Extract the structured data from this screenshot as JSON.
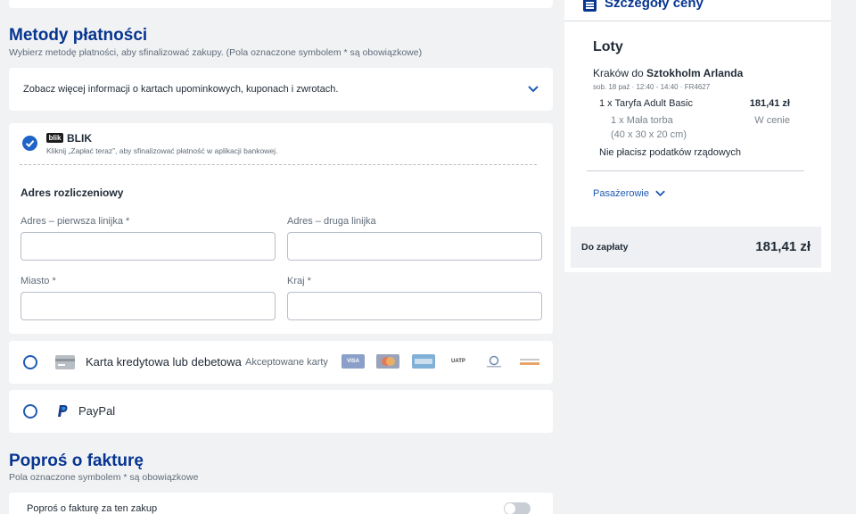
{
  "payment_methods": {
    "title": "Metody płatności",
    "subtitle": "Wybierz metodę płatności, aby sfinalizować zakupy.   (Pola oznaczone symbolem * są obowiązkowe)",
    "info_text": "Zobacz więcej informacji o kartach upominkowych, kuponach i zwrotach."
  },
  "blik": {
    "logo_text": "blik",
    "title": "BLIK",
    "description": "Kliknij „Zapłać teraz”, aby sfinalizować płatność w aplikacji bankowej.",
    "selected": true
  },
  "billing": {
    "title": "Adres rozliczeniowy",
    "address1_label": "Adres – pierwsza linijka *",
    "address2_label": "Adres – druga linijka",
    "city_label": "Miasto *",
    "country_label": "Kraj *",
    "address1_value": "",
    "address2_value": "",
    "city_value": "",
    "country_value": ""
  },
  "card_payment": {
    "label": "Karta kredytowa lub debetowa",
    "accepted_label": "Akceptowane karty",
    "logos": [
      "VISA",
      "MC",
      "AMEX",
      "UATP",
      "DINERS",
      "JCB"
    ]
  },
  "paypal": {
    "label": "PayPal"
  },
  "invoice": {
    "title": "Poproś o fakturę",
    "subtitle": "Pola oznaczone symbolem * są obowiązkowe",
    "toggle_label": "Poproś o fakturę za ten zakup",
    "toggle_on": false
  },
  "summary": {
    "title": "Szczegóły ceny",
    "section": "Loty",
    "route_from": "Kraków do ",
    "route_to": "Sztokholm Arlanda",
    "flight_meta": "sob. 18 paź  ·  12:40 - 14:40  ·  FR4627",
    "fare_label": "1 x Taryfa Adult Basic",
    "fare_price": "181,41 zł",
    "bag_label": "1 x Mała torba",
    "bag_size": "(40 x 30 x 20 cm)",
    "bag_price": "W cenie",
    "tax_note": "Nie płacisz podatków rządowych",
    "passengers_label": "Pasażerowie",
    "total_label": "Do zapłaty",
    "total_value": "181,41 zł"
  },
  "colors": {
    "brand_navy": "#073590",
    "accent_blue": "#1f63c6",
    "background": "#f1f2f4"
  }
}
